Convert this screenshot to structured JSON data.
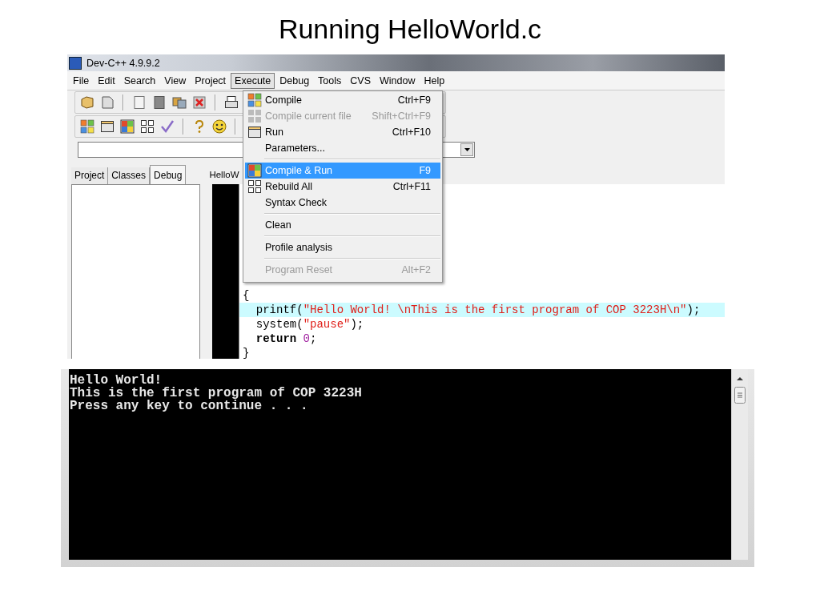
{
  "slide_title": "Running HelloWorld.c",
  "ide": {
    "window_title": "Dev-C++ 4.9.9.2",
    "menubar": [
      {
        "label": "File",
        "selected": false
      },
      {
        "label": "Edit",
        "selected": false
      },
      {
        "label": "Search",
        "selected": false
      },
      {
        "label": "View",
        "selected": false
      },
      {
        "label": "Project",
        "selected": false
      },
      {
        "label": "Execute",
        "selected": true
      },
      {
        "label": "Debug",
        "selected": false
      },
      {
        "label": "Tools",
        "selected": false
      },
      {
        "label": "CVS",
        "selected": false
      },
      {
        "label": "Window",
        "selected": false
      },
      {
        "label": "Help",
        "selected": false
      }
    ],
    "side_tabs": [
      {
        "label": "Project",
        "selected": false
      },
      {
        "label": "Classes",
        "selected": false
      },
      {
        "label": "Debug",
        "selected": true
      }
    ],
    "editor_tab": "HelloW",
    "code_lines": [
      {
        "highlighted": false,
        "tokens": [
          {
            "kind": "plain",
            "text": "{"
          }
        ]
      },
      {
        "highlighted": true,
        "tokens": [
          {
            "kind": "plain",
            "text": "  printf("
          },
          {
            "kind": "string",
            "text": "\"Hello World! \\nThis is the first program of COP 3223H\\n\""
          },
          {
            "kind": "plain",
            "text": ");"
          }
        ]
      },
      {
        "highlighted": false,
        "tokens": [
          {
            "kind": "plain",
            "text": "  system("
          },
          {
            "kind": "string",
            "text": "\"pause\""
          },
          {
            "kind": "plain",
            "text": ");"
          }
        ]
      },
      {
        "highlighted": false,
        "tokens": [
          {
            "kind": "keyword",
            "text": "  return"
          },
          {
            "kind": "number",
            "text": " 0"
          },
          {
            "kind": "plain",
            "text": ";"
          }
        ]
      },
      {
        "highlighted": false,
        "tokens": [
          {
            "kind": "plain",
            "text": "}"
          }
        ]
      }
    ],
    "execute_menu": [
      {
        "kind": "item",
        "label": "Compile",
        "shortcut": "Ctrl+F9",
        "disabled": false,
        "selected": false
      },
      {
        "kind": "item",
        "label": "Compile current file",
        "shortcut": "Shift+Ctrl+F9",
        "disabled": true,
        "selected": false
      },
      {
        "kind": "item",
        "label": "Run",
        "shortcut": "Ctrl+F10",
        "disabled": false,
        "selected": false
      },
      {
        "kind": "item",
        "label": "Parameters...",
        "disabled": false,
        "selected": false
      },
      {
        "kind": "separator"
      },
      {
        "kind": "item",
        "label": "Compile & Run",
        "shortcut": "F9",
        "disabled": false,
        "selected": true
      },
      {
        "kind": "item",
        "label": "Rebuild All",
        "shortcut": "Ctrl+F11",
        "disabled": false,
        "selected": false
      },
      {
        "kind": "item",
        "label": "Syntax Check",
        "disabled": false,
        "selected": false
      },
      {
        "kind": "separator"
      },
      {
        "kind": "item",
        "label": "Clean",
        "disabled": false,
        "selected": false
      },
      {
        "kind": "separator"
      },
      {
        "kind": "item",
        "label": "Profile analysis",
        "disabled": false,
        "selected": false
      },
      {
        "kind": "separator"
      },
      {
        "kind": "item",
        "label": "Program Reset",
        "shortcut": "Alt+F2",
        "disabled": true,
        "selected": false
      }
    ]
  },
  "console": {
    "lines": [
      "Hello World!",
      "This is the first program of COP 3223H",
      "Press any key to continue . . ."
    ]
  }
}
